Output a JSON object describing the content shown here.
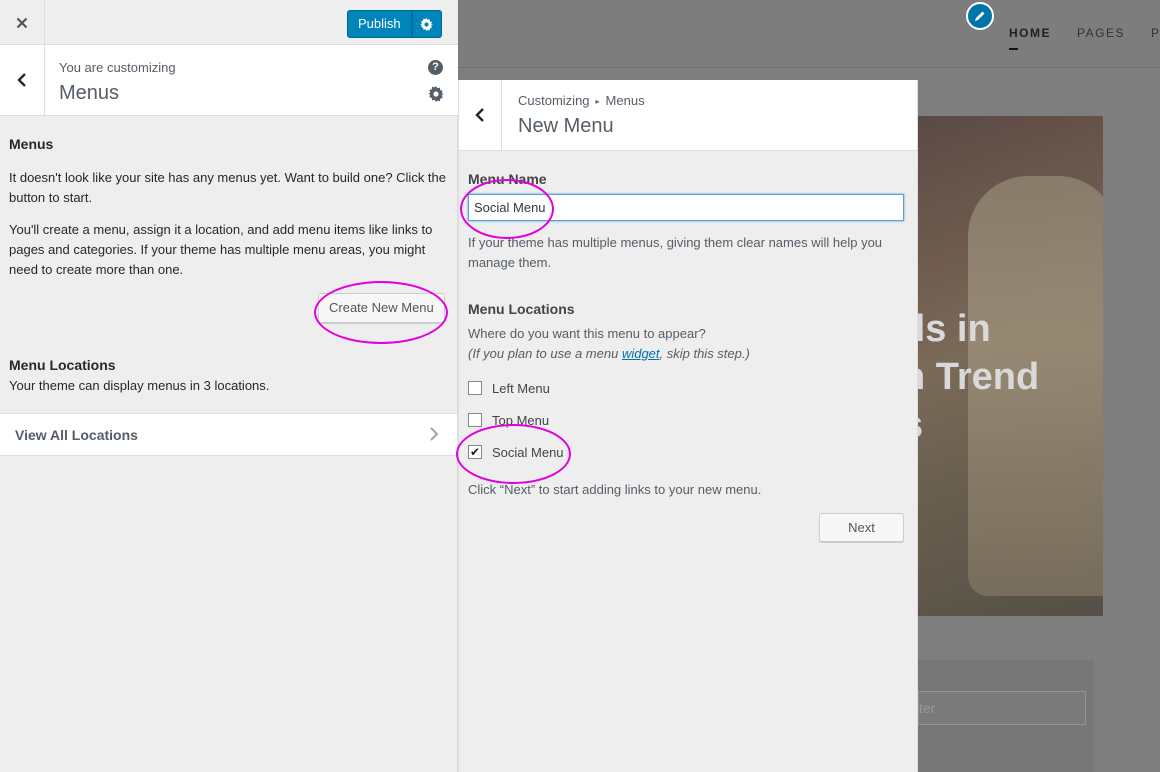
{
  "topbar": {
    "close_icon": "close-icon",
    "publish_label": "Publish",
    "publish_settings_icon": "gear-icon"
  },
  "section": {
    "customizing_label": "You are customizing",
    "title": "Menus",
    "help_icon": "question-icon",
    "settings_icon": "gear-icon"
  },
  "menus": {
    "heading": "Menus",
    "para1": "It doesn't look like your site has any menus yet. Want to build one? Click the button to start.",
    "para2": "You'll create a menu, assign it a location, and add menu items like links to pages and categories. If your theme has multiple menu areas, you might need to create more than one.",
    "create_button": "Create New Menu"
  },
  "locations": {
    "heading": "Menu Locations",
    "desc": "Your theme can display menus in 3 locations.",
    "view_all": "View All Locations"
  },
  "new_menu": {
    "breadcrumb_root": "Customizing",
    "breadcrumb_sep": "▸",
    "breadcrumb_current": "Menus",
    "title": "New Menu",
    "name_label": "Menu Name",
    "name_value": "Social Menu",
    "name_help": "If your theme has multiple menus, giving them clear names will help you manage them.",
    "locations_label": "Menu Locations",
    "locations_question": "Where do you want this menu to appear?",
    "locations_hint_pre": "(If you plan to use a menu ",
    "locations_hint_link": "widget",
    "locations_hint_post": ", skip this step.)",
    "checkboxes": [
      {
        "label": "Left Menu",
        "checked": false
      },
      {
        "label": "Top Menu",
        "checked": false
      },
      {
        "label": "Social Menu",
        "checked": true
      }
    ],
    "next_hint": "Click “Next” to start adding links to your new menu.",
    "next_button": "Next"
  },
  "preview": {
    "nav": [
      "HOME",
      "PAGES",
      "P"
    ],
    "hero_lines": [
      "ds in",
      "n Trend",
      "s"
    ],
    "search_placeholder": "ter",
    "colors": {
      "accent": "#0073aa",
      "annotation": "#e000e0"
    }
  }
}
